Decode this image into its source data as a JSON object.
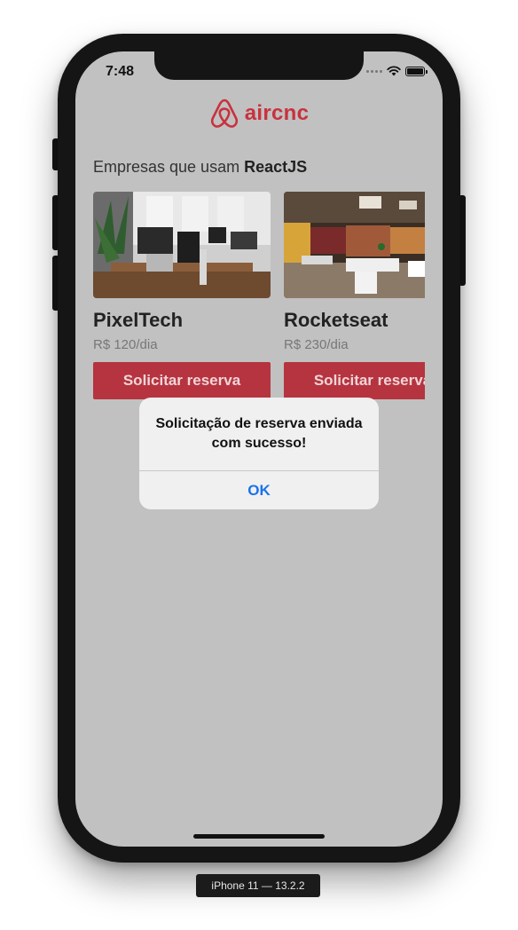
{
  "status_bar": {
    "time": "7:48"
  },
  "app": {
    "logo_text": "aircnc",
    "brand_color": "#c8323e"
  },
  "section": {
    "prefix": "Empresas que usam",
    "tech": "ReactJS"
  },
  "spots": [
    {
      "name": "PixelTech",
      "price": "R$ 120/dia",
      "button_label": "Solicitar reserva"
    },
    {
      "name": "Rocketseat",
      "price": "R$ 230/dia",
      "button_label": "Solicitar reserva"
    }
  ],
  "alert": {
    "message": "Solicitação de reserva enviada com sucesso!",
    "ok_label": "OK"
  },
  "simulator": {
    "device_label": "iPhone 11 — 13.2.2"
  },
  "icons": {
    "logo": "airbnb-belo-icon",
    "wifi": "wifi-icon",
    "battery": "battery-icon",
    "signal": "signal-dots-icon"
  }
}
